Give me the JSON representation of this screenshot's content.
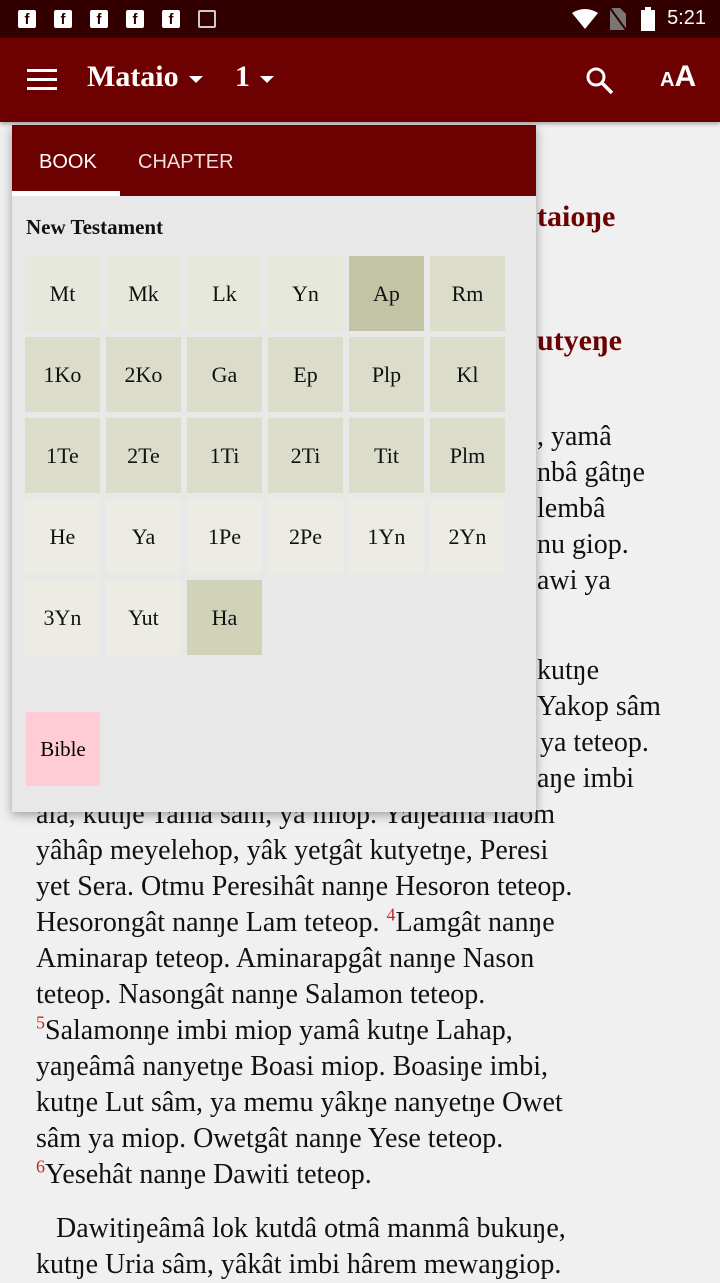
{
  "status": {
    "icons": [
      "facebook-icon",
      "facebook-icon",
      "facebook-icon",
      "facebook-icon",
      "facebook-icon",
      "image-icon"
    ],
    "time": "5:21"
  },
  "appbar": {
    "book": "Mataio",
    "chapter": "1"
  },
  "tabs": {
    "book": "BOOK",
    "chapter": "CHAPTER"
  },
  "section": "New Testament",
  "books": [
    {
      "abbr": "Mt",
      "color": "#e7e8dc"
    },
    {
      "abbr": "Mk",
      "color": "#e7e8dc"
    },
    {
      "abbr": "Lk",
      "color": "#e7e8dc"
    },
    {
      "abbr": "Yn",
      "color": "#e7e8dc"
    },
    {
      "abbr": "Ap",
      "color": "#c3c4a6"
    },
    {
      "abbr": "Rm",
      "color": "#dbdcc9"
    },
    {
      "abbr": "1Ko",
      "color": "#dbdcc9"
    },
    {
      "abbr": "2Ko",
      "color": "#dbdcc9"
    },
    {
      "abbr": "Ga",
      "color": "#dbdcc9"
    },
    {
      "abbr": "Ep",
      "color": "#dbdcc9"
    },
    {
      "abbr": "Plp",
      "color": "#dbdcc9"
    },
    {
      "abbr": "Kl",
      "color": "#dbdcc9"
    },
    {
      "abbr": "1Te",
      "color": "#dbdcc9"
    },
    {
      "abbr": "2Te",
      "color": "#dbdcc9"
    },
    {
      "abbr": "1Ti",
      "color": "#dbdcc9"
    },
    {
      "abbr": "2Ti",
      "color": "#dbdcc9"
    },
    {
      "abbr": "Tit",
      "color": "#dbdcc9"
    },
    {
      "abbr": "Plm",
      "color": "#dbdcc9"
    },
    {
      "abbr": "He",
      "color": "#ececE4"
    },
    {
      "abbr": "Ya",
      "color": "#ecece4"
    },
    {
      "abbr": "1Pe",
      "color": "#ecece4"
    },
    {
      "abbr": "2Pe",
      "color": "#ecece4"
    },
    {
      "abbr": "1Yn",
      "color": "#ecece4"
    },
    {
      "abbr": "2Yn",
      "color": "#ecece4"
    },
    {
      "abbr": "3Yn",
      "color": "#ecece4"
    },
    {
      "abbr": "Yut",
      "color": "#ecece4"
    },
    {
      "abbr": "Ha",
      "color": "#d1d3b9"
    }
  ],
  "bible_button": "Bible",
  "content": {
    "heading1": "taioŋe",
    "heading2": "utyeŋe",
    "fragments": [
      ", yamâ",
      "nbâ gâtŋe",
      "lembâ",
      "nu giop.",
      "awi ya",
      "",
      "kutŋe",
      "Yakop sâm",
      "ya teteop.",
      "aŋe imbi"
    ],
    "lines": [
      "ala, kutŋe Tama sâm, ya miop. Yaŋeamâ naom",
      "yâhâp meyelehop, yâk yetgât kutyetŋe, Peresi",
      "yet Sera. Otmu Peresihât nanŋe Hesoron teteop.",
      "Hesorongât nanŋe Lam teteop. "
    ],
    "v4": "4",
    "v4_text": "Lamgât nanŋe",
    "lines2": [
      "Aminarap teteop. Aminarapgât nanŋe Nason",
      "teteop. Nasongât nanŋe Salamon teteop."
    ],
    "v5": "5",
    "v5_text": "Salamonŋe imbi miop yamâ kutŋe Lahap,",
    "lines3": [
      "yaŋeâmâ nanyetŋe Boasi miop. Boasiŋe imbi,",
      "kutŋe Lut sâm, ya memu yâkŋe nanyetŋe Owet",
      "sâm ya miop. Owetgât nanŋe Yese teteop."
    ],
    "v6": "6",
    "v6_text": "Yesehât nanŋe Dawiti teteop.",
    "para2": [
      "Dawitiŋeâmâ lok kutdâ otmâ manmâ bukuŋe,",
      "kutŋe Uria sâm, yâkât imbi hârem mewaŋgiop."
    ]
  }
}
